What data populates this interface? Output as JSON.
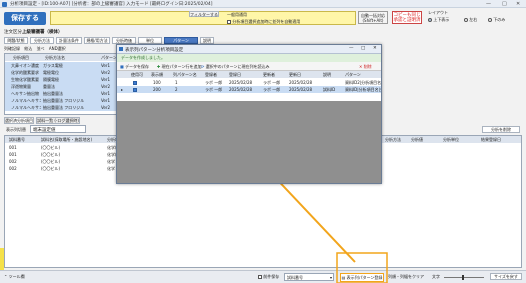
{
  "window": {
    "title": "分析項目設定 - [ID:100-A07] [分析者：部の上級審議官] 入力モード [最終ログイン日:2025/02/04]",
    "minimize": "—",
    "maximize": "□",
    "close": "✕"
  },
  "toolbar": {
    "save_label": "保存する",
    "filter_label": "フィルターする",
    "general_label": "一般用通用",
    "auto_label": "分析項目選択追加時に並列を自動適用",
    "btn_list_shift": "自動一括対応 (Shift+Alt)",
    "btn_copy_red": "コピーも同じ 承認と証明済",
    "layout_label": "レイアウト",
    "layout_options": [
      "上下表示",
      "左右",
      "下のみ"
    ]
  },
  "order": {
    "label": "注文区分",
    "value": "上級審議署（検体）"
  },
  "tabs": [
    "問題/状態",
    "分析方法",
    "計量法条件",
    "規格/用方法",
    "分析時価",
    "単位",
    "パターン",
    "説明"
  ],
  "options_line": {
    "label": "列確記録",
    "items": [
      "絞込",
      "並べ",
      "AND選択"
    ],
    "checkbox_label": "重量表の分析項目を複数的に表示"
  },
  "left_grid": {
    "columns": [
      "分析項目",
      "分析方法名",
      "パターン"
    ],
    "rows": [
      [
        "大鼻イオン濃度",
        "ガラス電極",
        "Ver1"
      ],
      [
        "化学的酸素要求",
        "電極電位",
        "Ver2"
      ],
      [
        "生物化学酸素要",
        "隔膜電極",
        "Ver1"
      ],
      [
        "浮遊物質量",
        "重量法",
        "Ver2"
      ],
      [
        "ヘキサン抽出物",
        "抽出重量法",
        "Ver1"
      ],
      [
        "ノルマルヘキサン",
        "抽出重量法 フロリジル",
        "Ver1"
      ],
      [
        "ノルマルヘキサン",
        "抽出重量法 フロリジル",
        "Ver2"
      ]
    ]
  },
  "lower_tabs": {
    "tab1": "選択済分析項目",
    "tab2": "試料一覧 (-ログ選択時)",
    "delete_btn": "分析を削除"
  },
  "lower_search": {
    "label": "表示列切替",
    "value": "端末設定値"
  },
  "lower_grid": {
    "columns": [
      "試料番号",
      "試料名(採取場所・施設地名)",
      "分析項目",
      "分析方法",
      "分析値",
      "分析単位",
      "結果登録日"
    ],
    "rows": [
      [
        "001",
        "(〇〇ビル)",
        "化学的酸素"
      ],
      [
        "001",
        "(〇〇ビル)",
        "化学的酸素"
      ],
      [
        "002",
        "(〇〇ビル)",
        "化学"
      ],
      [
        "002",
        "(〇〇ビル)",
        "化学"
      ]
    ]
  },
  "dialog": {
    "title": "表示列パターン分析項目設定",
    "info": "データを作成しました。",
    "tool_save": "データを保存",
    "tool_add": "現在パターン行を追加",
    "tool_update": "選択中のパターンに現在列を読込み",
    "tool_delete": "✕ 削除",
    "columns": [
      "使用可",
      "表示順",
      "列パターン名",
      "登録者",
      "登録日",
      "更新者",
      "更新日",
      "説明",
      "パターン"
    ],
    "rows": [
      {
        "checked": true,
        "order": "100",
        "name": "1",
        "creator": "ラボ 一郎",
        "created": "2025/02/28",
        "updater": "ラボ 一郎",
        "updated": "2025/02/28",
        "desc": "",
        "pattern": "資料ID2|分析項目名|分析方"
      },
      {
        "checked": true,
        "order": "200",
        "name": "2",
        "creator": "ラボ 一郎",
        "created": "2025/02/28",
        "updater": "ラボ 一郎",
        "updated": "2025/02/28",
        "desc": "試料ID",
        "pattern": "資料ID|分析項目名|分析方"
      }
    ]
  },
  "bottombar": {
    "left_label": "ツール欄",
    "file_label": "前件保存",
    "file_value": "試料番号",
    "pattern_btn": "表示列パターン登録",
    "reset_btn": "列順・列幅をクリア",
    "zoom_label": "文字",
    "layout_btn": "サイズを戻す"
  }
}
